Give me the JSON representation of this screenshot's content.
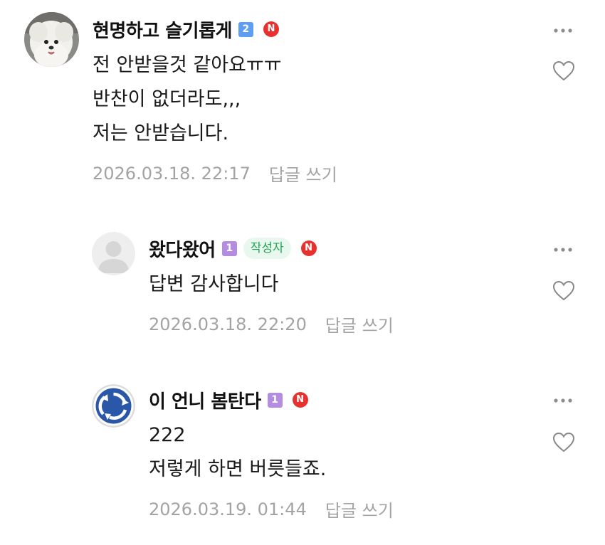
{
  "comments": [
    {
      "nickname": "현명하고 슬기롭게",
      "level": "2",
      "new_badge": "N",
      "lines": [
        "전 안받을것 같아요ㅠㅠ",
        "반찬이 없더라도,,,",
        "저는 안받습니다."
      ],
      "timestamp": "2026.03.18. 22:17",
      "reply_label": "답글 쓰기",
      "avatar": "white-dog-photo"
    },
    {
      "nickname": "왔다왔어",
      "level": "1",
      "author_badge": "작성자",
      "new_badge": "N",
      "lines": [
        "답변 감사합니다"
      ],
      "timestamp": "2026.03.18. 22:20",
      "reply_label": "답글 쓰기",
      "avatar": "default-person"
    },
    {
      "nickname": "이 언니 봄탄다",
      "level": "1",
      "new_badge": "N",
      "lines": [
        "222",
        "저렇게 하면 버릇들죠."
      ],
      "timestamp": "2026.03.19. 01:44",
      "reply_label": "답글 쓰기",
      "avatar": "roundabout-sign"
    }
  ],
  "colors": {
    "level_2": "#5d9ef2",
    "level_1": "#b48ce0",
    "new_badge": "#e8312f",
    "author_badge_bg": "#e9f8ee",
    "author_badge_text": "#23a559",
    "meta_text": "#a3a3a3"
  },
  "icons": {
    "more": "more-horizontal-icon",
    "like": "heart-outline-icon"
  }
}
